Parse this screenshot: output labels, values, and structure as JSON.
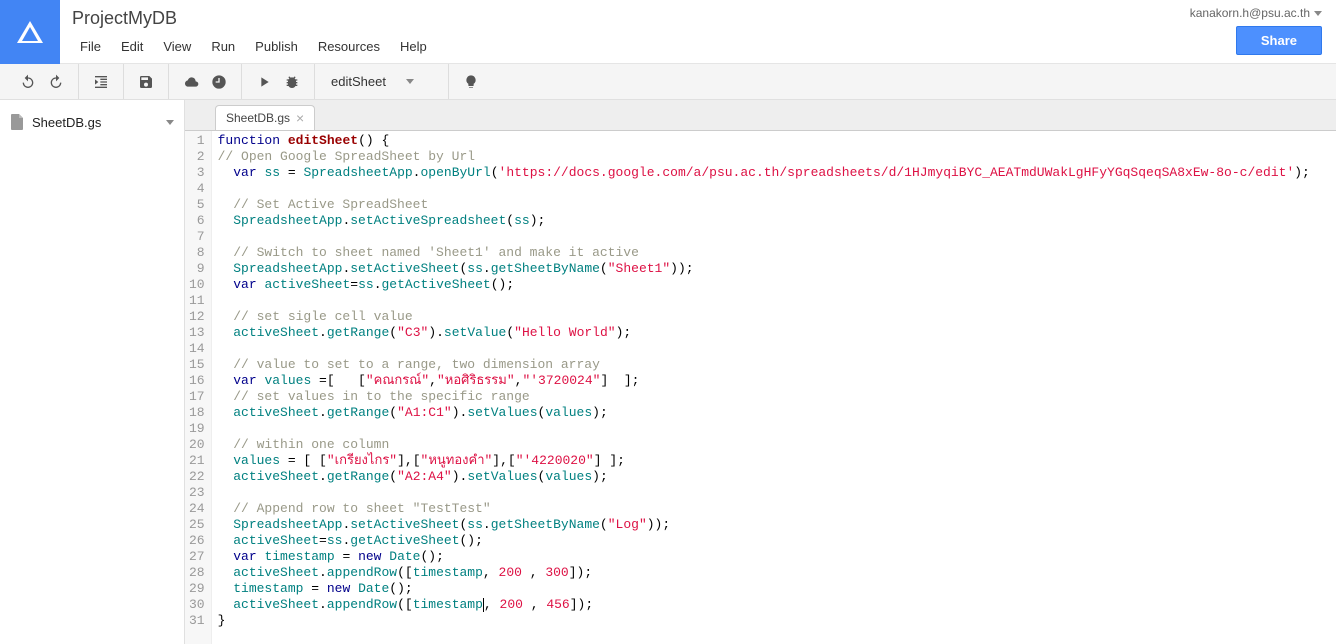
{
  "doc_title": "ProjectMyDB",
  "user_email": "kanakorn.h@psu.ac.th",
  "share_label": "Share",
  "menu": [
    "File",
    "Edit",
    "View",
    "Run",
    "Publish",
    "Resources",
    "Help"
  ],
  "function_selected": "editSheet",
  "sidebar_file": "SheetDB.gs",
  "tab_name": "SheetDB.gs",
  "code_lines": [
    [
      [
        "kw",
        "function"
      ],
      [
        "pln",
        " "
      ],
      [
        "fn",
        "editSheet"
      ],
      [
        "pln",
        "() {"
      ]
    ],
    [
      [
        "com",
        "// Open Google SpreadSheet by Url"
      ]
    ],
    [
      [
        "pln",
        "  "
      ],
      [
        "kw",
        "var"
      ],
      [
        "pln",
        " "
      ],
      [
        "var",
        "ss"
      ],
      [
        "pln",
        " = "
      ],
      [
        "var",
        "SpreadsheetApp"
      ],
      [
        "pln",
        "."
      ],
      [
        "var",
        "openByUrl"
      ],
      [
        "pln",
        "("
      ],
      [
        "str",
        "'https://docs.google.com/a/psu.ac.th/spreadsheets/d/1HJmyqiBYC_AEATmdUWakLgHFyYGqSqeqSA8xEw-8o-c/edit'"
      ],
      [
        "pln",
        ");"
      ]
    ],
    [
      [
        "pln",
        "  "
      ]
    ],
    [
      [
        "pln",
        "  "
      ],
      [
        "com",
        "// Set Active SpreadSheet"
      ]
    ],
    [
      [
        "pln",
        "  "
      ],
      [
        "var",
        "SpreadsheetApp"
      ],
      [
        "pln",
        "."
      ],
      [
        "var",
        "setActiveSpreadsheet"
      ],
      [
        "pln",
        "("
      ],
      [
        "var",
        "ss"
      ],
      [
        "pln",
        ");"
      ]
    ],
    [
      [
        "pln",
        "  "
      ]
    ],
    [
      [
        "pln",
        "  "
      ],
      [
        "com",
        "// Switch to sheet named 'Sheet1' and make it active"
      ]
    ],
    [
      [
        "pln",
        "  "
      ],
      [
        "var",
        "SpreadsheetApp"
      ],
      [
        "pln",
        "."
      ],
      [
        "var",
        "setActiveSheet"
      ],
      [
        "pln",
        "("
      ],
      [
        "var",
        "ss"
      ],
      [
        "pln",
        "."
      ],
      [
        "var",
        "getSheetByName"
      ],
      [
        "pln",
        "("
      ],
      [
        "str",
        "\"Sheet1\""
      ],
      [
        "pln",
        "));"
      ]
    ],
    [
      [
        "pln",
        "  "
      ],
      [
        "kw",
        "var"
      ],
      [
        "pln",
        " "
      ],
      [
        "var",
        "activeSheet"
      ],
      [
        "pln",
        "="
      ],
      [
        "var",
        "ss"
      ],
      [
        "pln",
        "."
      ],
      [
        "var",
        "getActiveSheet"
      ],
      [
        "pln",
        "();"
      ]
    ],
    [
      [
        "pln",
        "  "
      ]
    ],
    [
      [
        "pln",
        "  "
      ],
      [
        "com",
        "// set sigle cell value"
      ]
    ],
    [
      [
        "pln",
        "  "
      ],
      [
        "var",
        "activeSheet"
      ],
      [
        "pln",
        "."
      ],
      [
        "var",
        "getRange"
      ],
      [
        "pln",
        "("
      ],
      [
        "str",
        "\"C3\""
      ],
      [
        "pln",
        ")."
      ],
      [
        "var",
        "setValue"
      ],
      [
        "pln",
        "("
      ],
      [
        "str",
        "\"Hello World\""
      ],
      [
        "pln",
        ");"
      ]
    ],
    [
      [
        "pln",
        "  "
      ]
    ],
    [
      [
        "pln",
        "  "
      ],
      [
        "com",
        "// value to set to a range, two dimension array"
      ]
    ],
    [
      [
        "pln",
        "  "
      ],
      [
        "kw",
        "var"
      ],
      [
        "pln",
        " "
      ],
      [
        "var",
        "values"
      ],
      [
        "pln",
        " =[   ["
      ],
      [
        "str",
        "\"คณกรณ์\""
      ],
      [
        "pln",
        ","
      ],
      [
        "str",
        "\"หอศิริธรรม\""
      ],
      [
        "pln",
        ","
      ],
      [
        "str",
        "\"'3720024\""
      ],
      [
        "pln",
        "]  ];"
      ]
    ],
    [
      [
        "pln",
        "  "
      ],
      [
        "com",
        "// set values in to the specific range"
      ]
    ],
    [
      [
        "pln",
        "  "
      ],
      [
        "var",
        "activeSheet"
      ],
      [
        "pln",
        "."
      ],
      [
        "var",
        "getRange"
      ],
      [
        "pln",
        "("
      ],
      [
        "str",
        "\"A1:C1\""
      ],
      [
        "pln",
        ")."
      ],
      [
        "var",
        "setValues"
      ],
      [
        "pln",
        "("
      ],
      [
        "var",
        "values"
      ],
      [
        "pln",
        ");"
      ]
    ],
    [
      [
        "pln",
        "  "
      ]
    ],
    [
      [
        "pln",
        "  "
      ],
      [
        "com",
        "// within one column"
      ]
    ],
    [
      [
        "pln",
        "  "
      ],
      [
        "var",
        "values"
      ],
      [
        "pln",
        " = [ ["
      ],
      [
        "str",
        "\"เกรียงไกร\""
      ],
      [
        "pln",
        "],["
      ],
      [
        "str",
        "\"หนูทองคำ\""
      ],
      [
        "pln",
        "],["
      ],
      [
        "str",
        "\"'4220020\""
      ],
      [
        "pln",
        "] ];"
      ]
    ],
    [
      [
        "pln",
        "  "
      ],
      [
        "var",
        "activeSheet"
      ],
      [
        "pln",
        "."
      ],
      [
        "var",
        "getRange"
      ],
      [
        "pln",
        "("
      ],
      [
        "str",
        "\"A2:A4\""
      ],
      [
        "pln",
        ")."
      ],
      [
        "var",
        "setValues"
      ],
      [
        "pln",
        "("
      ],
      [
        "var",
        "values"
      ],
      [
        "pln",
        ");"
      ]
    ],
    [
      [
        "pln",
        "  "
      ]
    ],
    [
      [
        "pln",
        "  "
      ],
      [
        "com",
        "// Append row to sheet \"TestTest\""
      ]
    ],
    [
      [
        "pln",
        "  "
      ],
      [
        "var",
        "SpreadsheetApp"
      ],
      [
        "pln",
        "."
      ],
      [
        "var",
        "setActiveSheet"
      ],
      [
        "pln",
        "("
      ],
      [
        "var",
        "ss"
      ],
      [
        "pln",
        "."
      ],
      [
        "var",
        "getSheetByName"
      ],
      [
        "pln",
        "("
      ],
      [
        "str",
        "\"Log\""
      ],
      [
        "pln",
        "));"
      ]
    ],
    [
      [
        "pln",
        "  "
      ],
      [
        "var",
        "activeSheet"
      ],
      [
        "pln",
        "="
      ],
      [
        "var",
        "ss"
      ],
      [
        "pln",
        "."
      ],
      [
        "var",
        "getActiveSheet"
      ],
      [
        "pln",
        "();"
      ]
    ],
    [
      [
        "pln",
        "  "
      ],
      [
        "kw",
        "var"
      ],
      [
        "pln",
        " "
      ],
      [
        "var",
        "timestamp"
      ],
      [
        "pln",
        " = "
      ],
      [
        "kw",
        "new"
      ],
      [
        "pln",
        " "
      ],
      [
        "var",
        "Date"
      ],
      [
        "pln",
        "();"
      ]
    ],
    [
      [
        "pln",
        "  "
      ],
      [
        "var",
        "activeSheet"
      ],
      [
        "pln",
        "."
      ],
      [
        "var",
        "appendRow"
      ],
      [
        "pln",
        "(["
      ],
      [
        "var",
        "timestamp"
      ],
      [
        "pln",
        ", "
      ],
      [
        "lit",
        "200"
      ],
      [
        "pln",
        " , "
      ],
      [
        "lit",
        "300"
      ],
      [
        "pln",
        "]);"
      ]
    ],
    [
      [
        "pln",
        "  "
      ],
      [
        "var",
        "timestamp"
      ],
      [
        "pln",
        " = "
      ],
      [
        "kw",
        "new"
      ],
      [
        "pln",
        " "
      ],
      [
        "var",
        "Date"
      ],
      [
        "pln",
        "();"
      ]
    ],
    [
      [
        "pln",
        "  "
      ],
      [
        "var",
        "activeSheet"
      ],
      [
        "pln",
        "."
      ],
      [
        "var",
        "appendRow"
      ],
      [
        "pln",
        "(["
      ],
      [
        "var",
        "timestamp"
      ],
      [
        "caret",
        ""
      ],
      [
        "pln",
        ", "
      ],
      [
        "lit",
        "200"
      ],
      [
        "pln",
        " , "
      ],
      [
        "lit",
        "456"
      ],
      [
        "pln",
        "]);"
      ]
    ],
    [
      [
        "pln",
        "}"
      ]
    ]
  ]
}
